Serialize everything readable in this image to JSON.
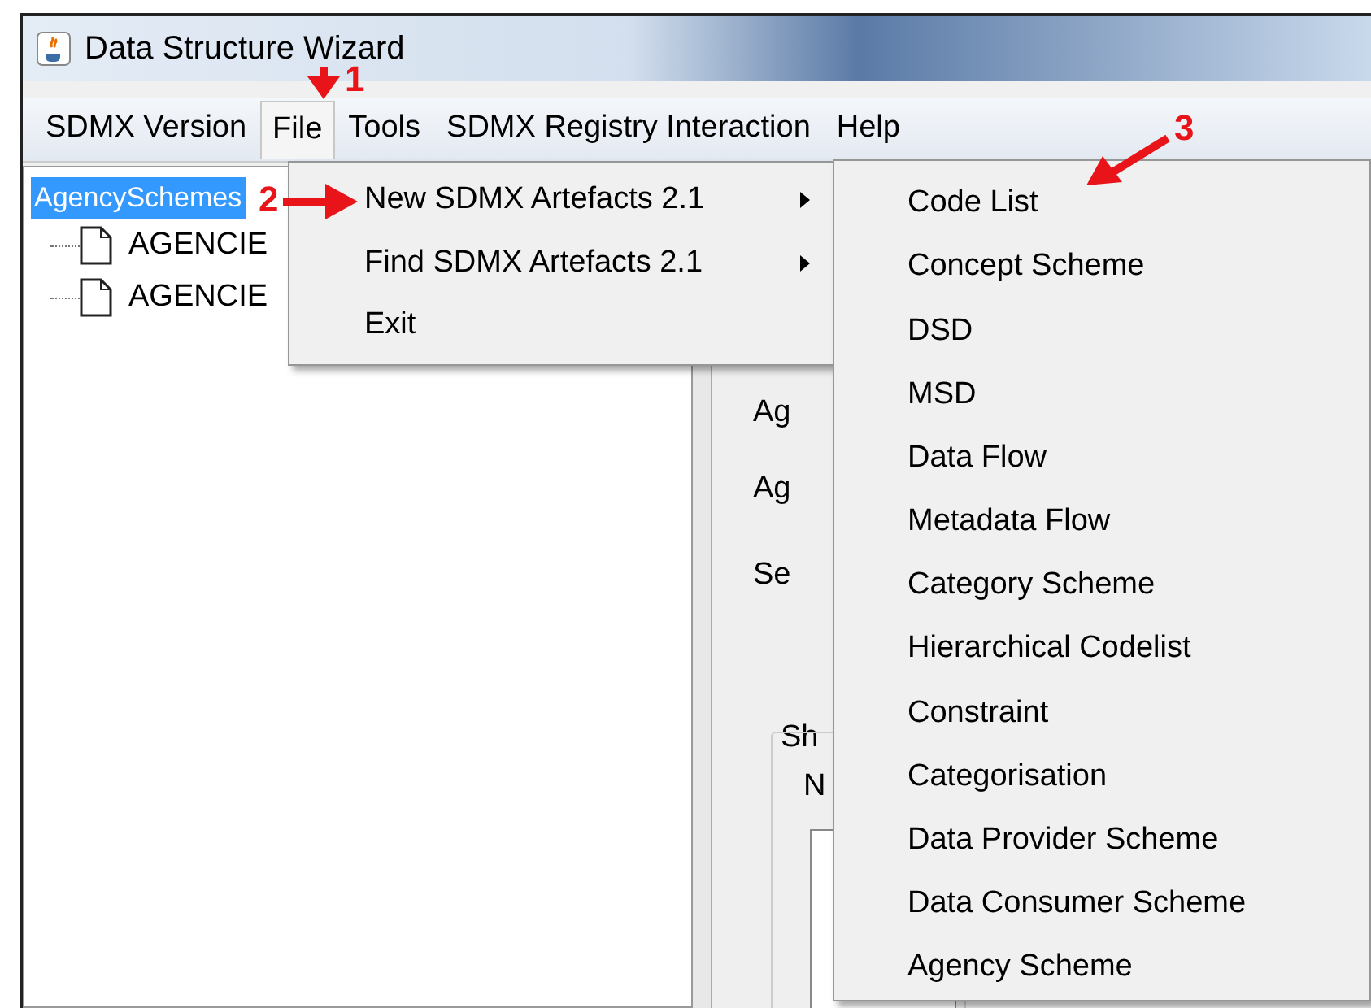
{
  "window": {
    "title": "Data Structure Wizard"
  },
  "menu_bar": [
    {
      "label": "SDMX Version",
      "selected": false
    },
    {
      "label": "File",
      "selected": true
    },
    {
      "label": "Tools",
      "selected": false
    },
    {
      "label": "SDMX Registry Interaction",
      "selected": false
    },
    {
      "label": "Help",
      "selected": false
    }
  ],
  "tree": {
    "label": "AgencySchemes",
    "selected": true,
    "children": [
      {
        "label": "AGENCIE",
        "selected": false
      },
      {
        "label": "AGENCIE",
        "selected": false
      }
    ]
  },
  "form_labels": [
    "Ag",
    "Ag",
    "Se",
    "Sh",
    "N"
  ],
  "file_menu": [
    {
      "label": "New SDMX Artefacts 2.1",
      "has_submenu": true
    },
    {
      "label": "Find SDMX Artefacts 2.1",
      "has_submenu": true
    },
    {
      "label": "Exit",
      "has_submenu": false
    }
  ],
  "submenu": [
    "Code List",
    "Concept Scheme",
    "DSD",
    "MSD",
    "Data Flow",
    "Metadata Flow",
    "Category Scheme",
    "Hierarchical Codelist",
    "Constraint",
    "Categorisation",
    "Data Provider Scheme",
    "Data Consumer Scheme",
    "Agency Scheme"
  ],
  "annotations": [
    {
      "kind": "down",
      "label": "1"
    },
    {
      "kind": "right",
      "label": "2"
    },
    {
      "kind": "diagonal",
      "label": "3"
    }
  ]
}
